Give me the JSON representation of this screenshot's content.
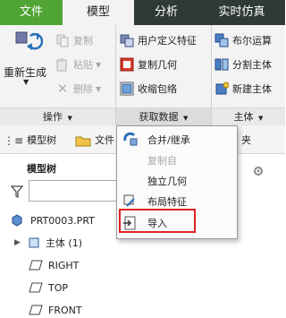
{
  "tabs": [
    {
      "label": "文件"
    },
    {
      "label": "模型"
    },
    {
      "label": "分析"
    },
    {
      "label": "实时仿真"
    }
  ],
  "ribbon": {
    "regenerate_label": "重新生成",
    "copy_label": "复制",
    "paste_label": "粘贴",
    "delete_label": "删除",
    "group_operations": "操作",
    "user_defined_feature": "用户定义特征",
    "copy_geometry": "复制几何",
    "shrinkwrap": "收缩包络",
    "group_get_data": "获取数据",
    "boolean_ops": "布尔运算",
    "split_body": "分割主体",
    "new_body": "新建主体",
    "group_body": "主体"
  },
  "panel": {
    "tab_model_tree": "模型树",
    "tab_files": "文件",
    "tab_fav_partial": "夹",
    "title": "模型树",
    "tree": [
      {
        "label": "PRT0003.PRT"
      },
      {
        "label": "主体 (1)"
      },
      {
        "label": "RIGHT"
      },
      {
        "label": "TOP"
      },
      {
        "label": "FRONT"
      }
    ]
  },
  "dropdown": {
    "items": [
      {
        "label": "合并/继承",
        "enabled": true
      },
      {
        "label": "复制自",
        "enabled": false
      },
      {
        "label": "独立几何",
        "enabled": true
      },
      {
        "label": "布局特征",
        "enabled": true
      },
      {
        "label": "导入",
        "enabled": true,
        "highlighted": true
      }
    ]
  },
  "colors": {
    "file_tab": "#4fa433",
    "tab_bar": "#2f3a35",
    "highlight_box": "#e02222"
  }
}
